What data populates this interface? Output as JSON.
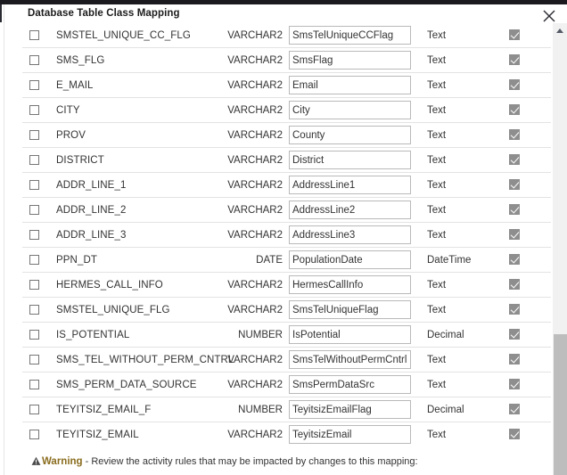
{
  "dialog": {
    "title": "Database Table Class Mapping",
    "close_icon": "close-icon"
  },
  "table": {
    "rows": [
      {
        "db_column": "SMSTEL_UNIQUE_CC_FLG",
        "db_type": "VARCHAR2",
        "attribute": "SmsTelUniqueCCFlag",
        "data_type": "Text",
        "selected": false,
        "enabled": true
      },
      {
        "db_column": "SMS_FLG",
        "db_type": "VARCHAR2",
        "attribute": "SmsFlag",
        "data_type": "Text",
        "selected": false,
        "enabled": true
      },
      {
        "db_column": "E_MAIL",
        "db_type": "VARCHAR2",
        "attribute": "Email",
        "data_type": "Text",
        "selected": false,
        "enabled": true
      },
      {
        "db_column": "CITY",
        "db_type": "VARCHAR2",
        "attribute": "City",
        "data_type": "Text",
        "selected": false,
        "enabled": true
      },
      {
        "db_column": "PROV",
        "db_type": "VARCHAR2",
        "attribute": "County",
        "data_type": "Text",
        "selected": false,
        "enabled": true
      },
      {
        "db_column": "DISTRICT",
        "db_type": "VARCHAR2",
        "attribute": "District",
        "data_type": "Text",
        "selected": false,
        "enabled": true
      },
      {
        "db_column": "ADDR_LINE_1",
        "db_type": "VARCHAR2",
        "attribute": "AddressLine1",
        "data_type": "Text",
        "selected": false,
        "enabled": true
      },
      {
        "db_column": "ADDR_LINE_2",
        "db_type": "VARCHAR2",
        "attribute": "AddressLine2",
        "data_type": "Text",
        "selected": false,
        "enabled": true
      },
      {
        "db_column": "ADDR_LINE_3",
        "db_type": "VARCHAR2",
        "attribute": "AddressLine3",
        "data_type": "Text",
        "selected": false,
        "enabled": true
      },
      {
        "db_column": "PPN_DT",
        "db_type": "DATE",
        "attribute": "PopulationDate",
        "data_type": "DateTime",
        "selected": false,
        "enabled": true
      },
      {
        "db_column": "HERMES_CALL_INFO",
        "db_type": "VARCHAR2",
        "attribute": "HermesCallInfo",
        "data_type": "Text",
        "selected": false,
        "enabled": true
      },
      {
        "db_column": "SMSTEL_UNIQUE_FLG",
        "db_type": "VARCHAR2",
        "attribute": "SmsTelUniqueFlag",
        "data_type": "Text",
        "selected": false,
        "enabled": true
      },
      {
        "db_column": "IS_POTENTIAL",
        "db_type": "NUMBER",
        "attribute": "IsPotential",
        "data_type": "Decimal",
        "selected": false,
        "enabled": true
      },
      {
        "db_column": "SMS_TEL_WITHOUT_PERM_CNTRL",
        "db_type": "VARCHAR2",
        "attribute": "SmsTelWithoutPermCntrl",
        "data_type": "Text",
        "selected": false,
        "enabled": true
      },
      {
        "db_column": "SMS_PERM_DATA_SOURCE",
        "db_type": "VARCHAR2",
        "attribute": "SmsPermDataSrc",
        "data_type": "Text",
        "selected": false,
        "enabled": true
      },
      {
        "db_column": "TEYITSIZ_EMAIL_F",
        "db_type": "NUMBER",
        "attribute": "TeyitsizEmailFlag",
        "data_type": "Decimal",
        "selected": false,
        "enabled": true
      },
      {
        "db_column": "TEYITSIZ_EMAIL",
        "db_type": "VARCHAR2",
        "attribute": "TeyitsizEmail",
        "data_type": "Text",
        "selected": false,
        "enabled": true
      }
    ]
  },
  "warning": {
    "icon": "warning-triangle-icon",
    "label": "Warning",
    "text": " - Review the activity rules that may be impacted by changes to this mapping:",
    "label_color": "#8a6d1f"
  },
  "scrollbar": {
    "up_arrow_icon": "chevron-up-icon",
    "thumb": "scrollbar-thumb"
  }
}
